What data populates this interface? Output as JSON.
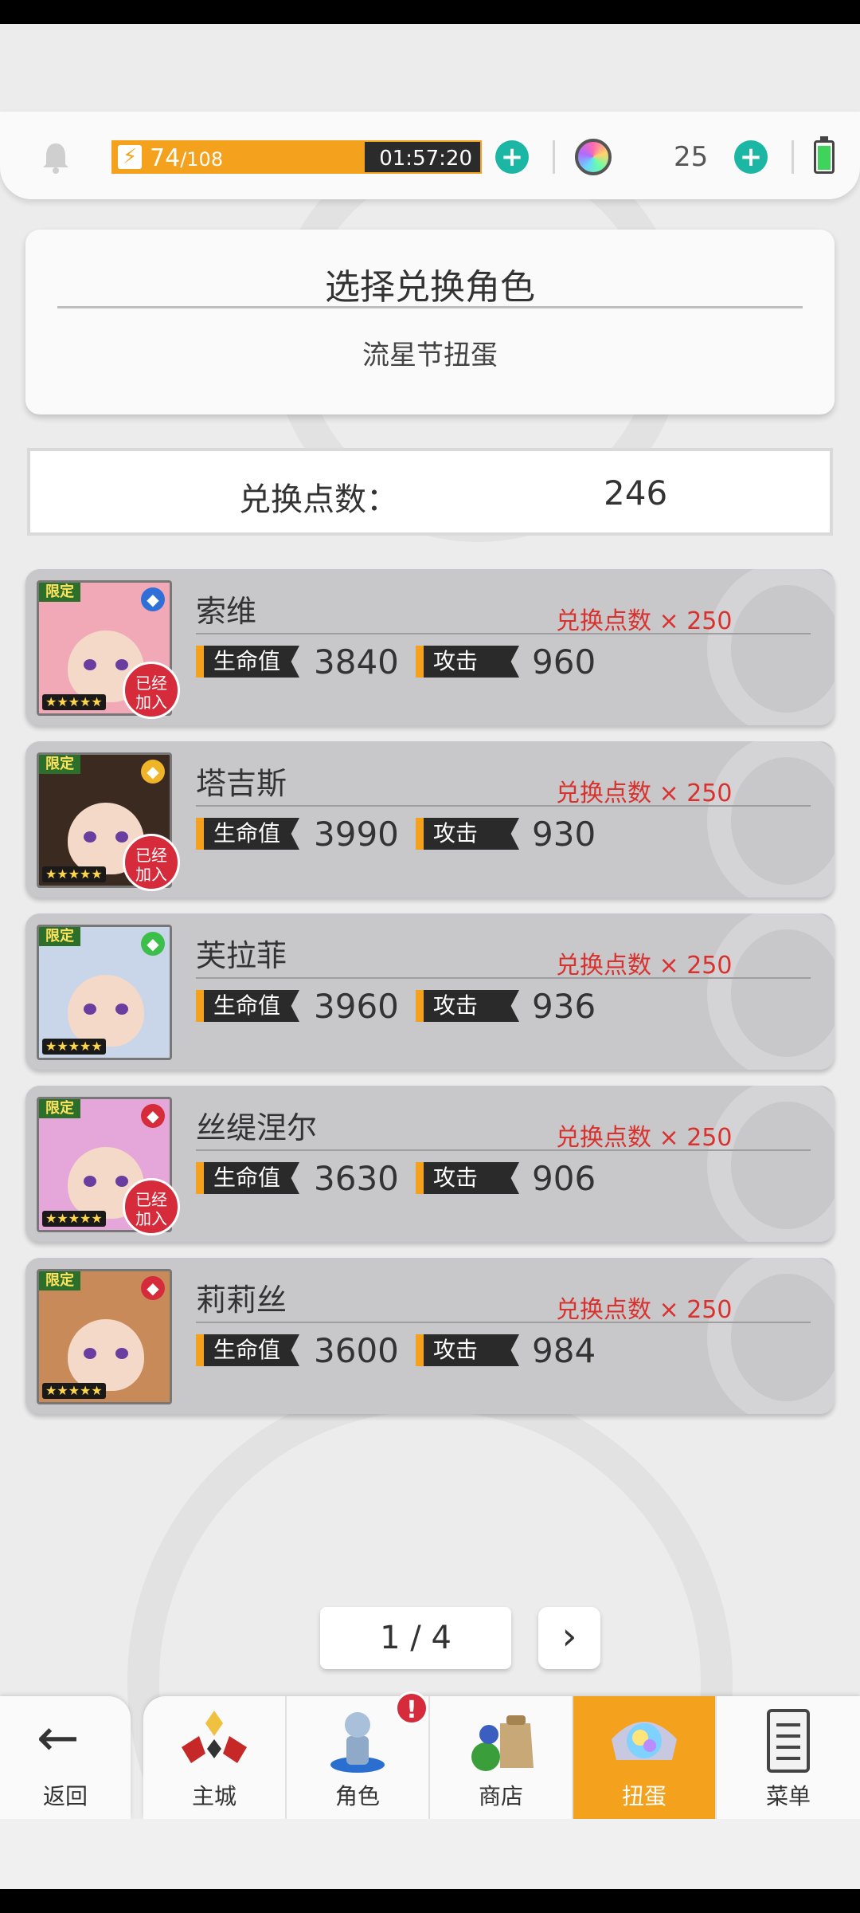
{
  "topbar": {
    "stamina_current": "74",
    "stamina_max": "/108",
    "stamina_fraction": 0.685,
    "stamina_timer": "01:57:20",
    "gem_count": "25",
    "icons": [
      "bell-icon",
      "lightning-icon",
      "plus-icon",
      "gem-icon",
      "plus-icon",
      "battery-icon"
    ]
  },
  "header": {
    "title": "选择兑换角色",
    "subtitle": "流星节扭蛋"
  },
  "points": {
    "label": "兑换点数：",
    "value": "246"
  },
  "characters": [
    {
      "name": "索维",
      "cost": "兑换点数 × 250",
      "hp_label": "生命值",
      "hp": "3840",
      "atk_label": "攻击",
      "atk": "960",
      "joined": true,
      "joined_label": "已经\n加入",
      "tag": "限定",
      "stars": "★★★★★",
      "element_icon": "water-orb-icon",
      "element_color": "#2f6fd8",
      "hair_color": "#f1a9b8"
    },
    {
      "name": "塔吉斯",
      "cost": "兑换点数 × 250",
      "hp_label": "生命值",
      "hp": "3990",
      "atk_label": "攻击",
      "atk": "930",
      "joined": true,
      "joined_label": "已经\n加入",
      "tag": "限定",
      "stars": "★★★★★",
      "element_icon": "lightning-icon",
      "element_color": "#f0b428",
      "hair_color": "#3a2a20"
    },
    {
      "name": "芙拉菲",
      "cost": "兑换点数 × 250",
      "hp_label": "生命值",
      "hp": "3960",
      "atk_label": "攻击",
      "atk": "936",
      "joined": false,
      "joined_label": "",
      "tag": "限定",
      "stars": "★★★★★",
      "element_icon": "leaf-icon",
      "element_color": "#3bbf4a",
      "hair_color": "#c9d6ea"
    },
    {
      "name": "丝缇涅尔",
      "cost": "兑换点数 × 250",
      "hp_label": "生命值",
      "hp": "3630",
      "atk_label": "攻击",
      "atk": "906",
      "joined": true,
      "joined_label": "已经\n加入",
      "tag": "限定",
      "stars": "★★★★★",
      "element_icon": "diamond-icon",
      "element_color": "#d62b3a",
      "hair_color": "#e5a6da"
    },
    {
      "name": "莉莉丝",
      "cost": "兑换点数 × 250",
      "hp_label": "生命值",
      "hp": "3600",
      "atk_label": "攻击",
      "atk": "984",
      "joined": false,
      "joined_label": "",
      "tag": "限定",
      "stars": "★★★★★",
      "element_icon": "diamond-icon",
      "element_color": "#d62b3a",
      "hair_color": "#c98a5a"
    }
  ],
  "pager": {
    "text": "1 / 4",
    "next": "›"
  },
  "nav": {
    "back_label": "返回",
    "back_arrow": "←",
    "tabs": [
      {
        "label": "主城",
        "icon": "castle-icon"
      },
      {
        "label": "角色",
        "icon": "character-icon",
        "badge": "!"
      },
      {
        "label": "商店",
        "icon": "shop-icon"
      },
      {
        "label": "扭蛋",
        "icon": "gacha-icon",
        "active": true
      },
      {
        "label": "菜单",
        "icon": "menu-list-icon"
      }
    ]
  },
  "colors": {
    "accent": "#f4a11d",
    "teal": "#1bb7a4",
    "red": "#d8322f"
  }
}
